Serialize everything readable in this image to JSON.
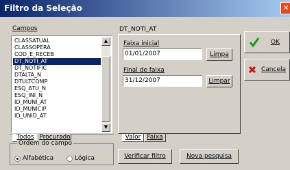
{
  "window": {
    "title": "Filtro da Seleção"
  },
  "fields_panel": {
    "label": "Campos",
    "items": [
      "CLASSATUAL",
      "CLASSOPERA",
      "COD_E_RECEB",
      "DT_NOTI_AT",
      "DT_NOTIFIC",
      "DTALTA_N",
      "DTULTCOMP",
      "ESQ_ATU_N",
      "ESQ_INI_N",
      "ID_MUNI_AT",
      "ID_MUNICIP",
      "ID_UNID_AT"
    ],
    "selected_index": 3,
    "tabs": [
      {
        "label": "Todos",
        "active": true
      },
      {
        "label": "Procurado",
        "active": false
      }
    ]
  },
  "ordem": {
    "label": "Ordem do campo",
    "options": [
      {
        "label": "Alfabética",
        "checked": true
      },
      {
        "label": "Lógica",
        "checked": false
      }
    ]
  },
  "filter_panel": {
    "field_name": "DT_NOTI_AT",
    "faixa_inicial": {
      "label": "Faixa inicial",
      "value": "01/01/2007",
      "clear_label": "Limpa"
    },
    "final_faixa": {
      "label": "Final de faixa",
      "value": "31/12/2007",
      "clear_label": "Limpar"
    },
    "tabs": [
      {
        "label": "Valor",
        "active": true
      },
      {
        "label": "Faixa",
        "active": false
      }
    ]
  },
  "buttons": {
    "ok": "OK",
    "cancel": "Cancela",
    "verify": "Verificar filtro",
    "new_search": "Nova pesquisa"
  },
  "colors": {
    "title_start": "#0a246a",
    "title_end": "#a6caf0",
    "selection": "#0a246a",
    "ok_icon": "#1a9a1a",
    "cancel_icon": "#d01010"
  }
}
